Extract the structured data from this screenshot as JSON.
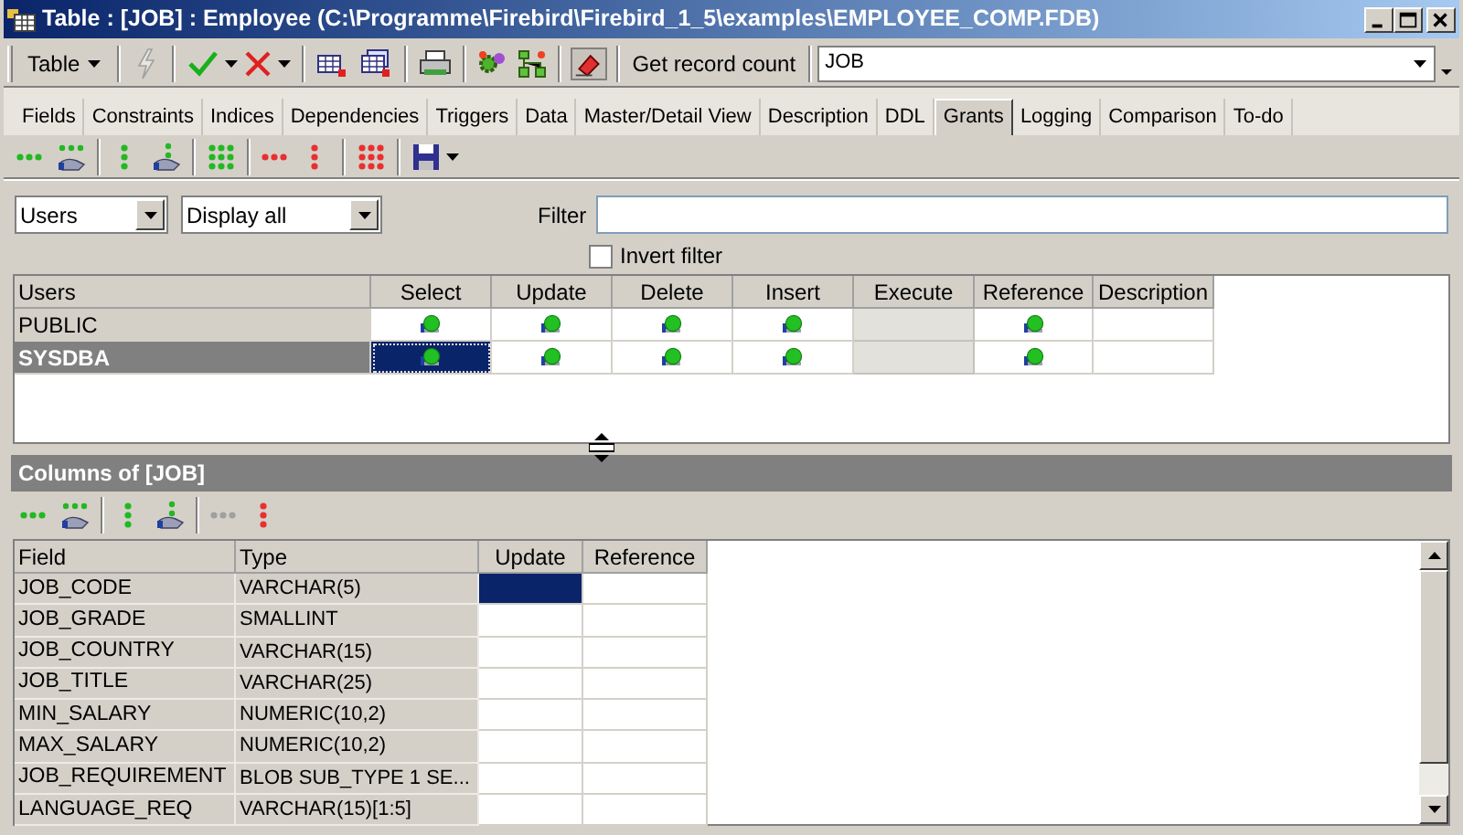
{
  "window": {
    "title": "Table : [JOB] : Employee (C:\\Programme\\Firebird\\Firebird_1_5\\examples\\EMPLOYEE_COMP.FDB)"
  },
  "toolbar": {
    "table_button": "Table",
    "record_count_button": "Get record count",
    "table_combo": "JOB"
  },
  "tabs": [
    {
      "label": "Fields",
      "selected": false
    },
    {
      "label": "Constraints",
      "selected": false
    },
    {
      "label": "Indices",
      "selected": false
    },
    {
      "label": "Dependencies",
      "selected": false
    },
    {
      "label": "Triggers",
      "selected": false
    },
    {
      "label": "Data",
      "selected": false
    },
    {
      "label": "Master/Detail View",
      "selected": false
    },
    {
      "label": "Description",
      "selected": false
    },
    {
      "label": "DDL",
      "selected": false
    },
    {
      "label": "Grants",
      "selected": true
    },
    {
      "label": "Logging",
      "selected": false
    },
    {
      "label": "Comparison",
      "selected": false
    },
    {
      "label": "To-do",
      "selected": false
    }
  ],
  "filter_bar": {
    "object_type": "Users",
    "display": "Display all",
    "filter_label": "Filter",
    "invert_filter": {
      "label": "Invert filter",
      "checked": false
    }
  },
  "grants": {
    "columns": [
      "Users",
      "Select",
      "Update",
      "Delete",
      "Insert",
      "Execute",
      "Reference",
      "Description"
    ],
    "rows": [
      {
        "user": "PUBLIC",
        "selected": false,
        "cells": [
          {
            "granted": true,
            "disabled": false,
            "focused": false
          },
          {
            "granted": true,
            "disabled": false,
            "focused": false
          },
          {
            "granted": true,
            "disabled": false,
            "focused": false
          },
          {
            "granted": true,
            "disabled": false,
            "focused": false
          },
          {
            "granted": false,
            "disabled": true,
            "focused": false
          },
          {
            "granted": true,
            "disabled": false,
            "focused": false
          },
          {
            "granted": false,
            "disabled": false,
            "focused": false
          }
        ]
      },
      {
        "user": "SYSDBA",
        "selected": true,
        "cells": [
          {
            "granted": true,
            "disabled": false,
            "focused": true
          },
          {
            "granted": true,
            "disabled": false,
            "focused": false
          },
          {
            "granted": true,
            "disabled": false,
            "focused": false
          },
          {
            "granted": true,
            "disabled": false,
            "focused": false
          },
          {
            "granted": false,
            "disabled": true,
            "focused": false
          },
          {
            "granted": true,
            "disabled": false,
            "focused": false
          },
          {
            "granted": false,
            "disabled": false,
            "focused": false
          }
        ]
      }
    ]
  },
  "columns_panel": {
    "title": "Columns of [JOB]",
    "columns": [
      "Field",
      "Type",
      "Update",
      "Reference"
    ],
    "rows": [
      {
        "field": "JOB_CODE",
        "type": "VARCHAR(5)",
        "cells": [
          {
            "focused": true
          },
          {
            "focused": false
          }
        ]
      },
      {
        "field": "JOB_GRADE",
        "type": "SMALLINT",
        "cells": [
          {
            "focused": false
          },
          {
            "focused": false
          }
        ]
      },
      {
        "field": "JOB_COUNTRY",
        "type": "VARCHAR(15)",
        "cells": [
          {
            "focused": false
          },
          {
            "focused": false
          }
        ]
      },
      {
        "field": "JOB_TITLE",
        "type": "VARCHAR(25)",
        "cells": [
          {
            "focused": false
          },
          {
            "focused": false
          }
        ]
      },
      {
        "field": "MIN_SALARY",
        "type": "NUMERIC(10,2)",
        "cells": [
          {
            "focused": false
          },
          {
            "focused": false
          }
        ]
      },
      {
        "field": "MAX_SALARY",
        "type": "NUMERIC(10,2)",
        "cells": [
          {
            "focused": false
          },
          {
            "focused": false
          }
        ]
      },
      {
        "field": "JOB_REQUIREMENT",
        "type": "BLOB SUB_TYPE 1 SE...",
        "cells": [
          {
            "focused": false
          },
          {
            "focused": false
          }
        ]
      },
      {
        "field": "LANGUAGE_REQ",
        "type": "VARCHAR(15)[1:5]",
        "cells": [
          {
            "focused": false
          },
          {
            "focused": false
          }
        ]
      }
    ]
  }
}
